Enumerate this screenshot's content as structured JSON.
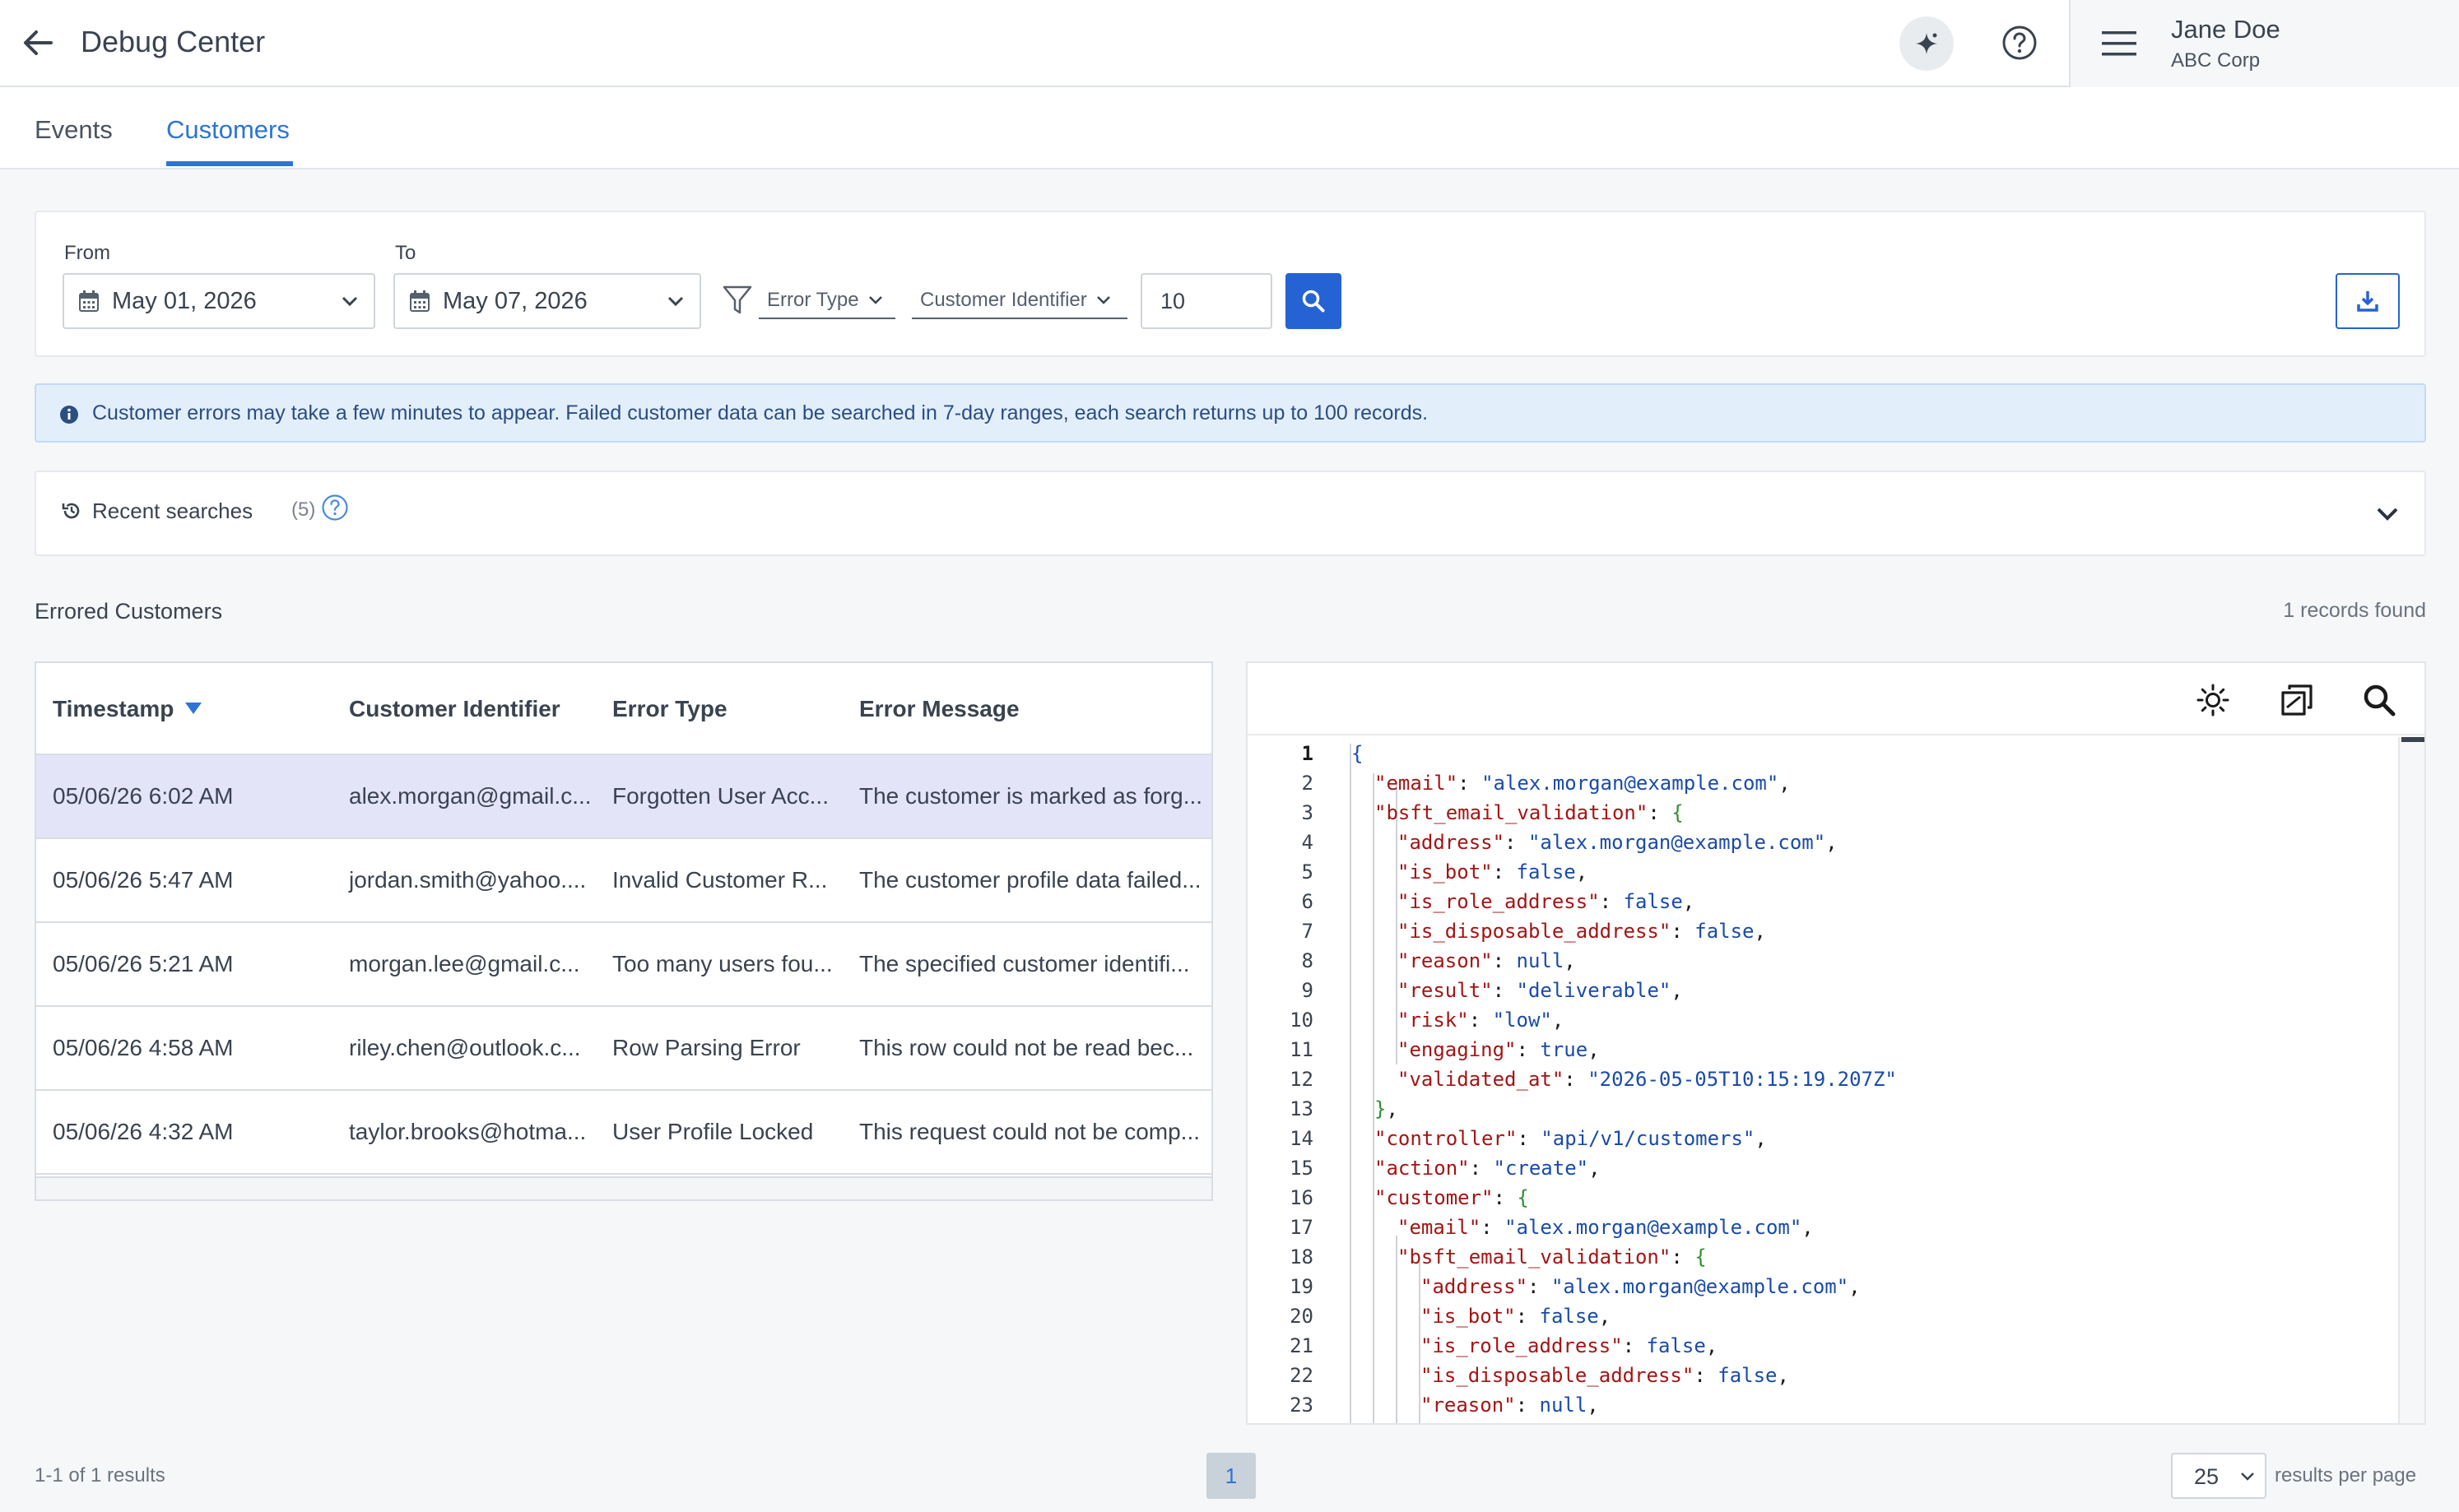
{
  "header": {
    "title": "Debug Center",
    "user_name": "Jane Doe",
    "user_org": "ABC Corp"
  },
  "tabs": [
    {
      "label": "Events",
      "active": false
    },
    {
      "label": "Customers",
      "active": true
    }
  ],
  "filters": {
    "from_label": "From",
    "from_value": "May 01, 2026",
    "to_label": "To",
    "to_value": "May 07, 2026",
    "error_type_label": "Error Type",
    "customer_identifier_label": "Customer Identifier",
    "limit_value": "10"
  },
  "info_banner": "Customer errors may take a few minutes to appear. Failed customer data can be searched in 7-day ranges, each search returns up to 100 records.",
  "recent_searches": {
    "label": "Recent searches",
    "count": "(5)"
  },
  "errored": {
    "title": "Errored Customers",
    "records_found": "1 records found"
  },
  "table": {
    "columns": [
      "Timestamp",
      "Customer Identifier",
      "Error Type",
      "Error Message"
    ],
    "rows": [
      {
        "timestamp": "05/06/26 6:02 AM",
        "identifier": "alex.morgan@gmail.c...",
        "error_type": "Forgotten User Acc...",
        "message": "The customer is marked as forg...",
        "selected": true
      },
      {
        "timestamp": "05/06/26 5:47 AM",
        "identifier": "jordan.smith@yahoo....",
        "error_type": "Invalid Customer R...",
        "message": "The customer profile data failed...",
        "selected": false
      },
      {
        "timestamp": "05/06/26 5:21 AM",
        "identifier": "morgan.lee@gmail.c...",
        "error_type": "Too many users fou...",
        "message": "The specified customer identifi...",
        "selected": false
      },
      {
        "timestamp": "05/06/26 4:58 AM",
        "identifier": "riley.chen@outlook.c...",
        "error_type": "Row Parsing Error",
        "message": "This row could not be read bec...",
        "selected": false
      },
      {
        "timestamp": "05/06/26 4:32 AM",
        "identifier": "taylor.brooks@hotma...",
        "error_type": "User Profile Locked",
        "message": "This request could not be comp...",
        "selected": false
      }
    ]
  },
  "json_viewer": {
    "icons": [
      "theme-icon",
      "copy-icon",
      "search-icon"
    ],
    "lines": [
      {
        "n": "1",
        "indent": 0,
        "parts": [
          [
            "br1",
            "{"
          ]
        ]
      },
      {
        "n": "2",
        "indent": 1,
        "parts": [
          [
            "k",
            "\"email\""
          ],
          [
            "p",
            ": "
          ],
          [
            "s",
            "\"alex.morgan@example.com\""
          ],
          [
            "p",
            ","
          ]
        ]
      },
      {
        "n": "3",
        "indent": 1,
        "parts": [
          [
            "k",
            "\"bsft_email_validation\""
          ],
          [
            "p",
            ": "
          ],
          [
            "br2",
            "{"
          ]
        ]
      },
      {
        "n": "4",
        "indent": 2,
        "parts": [
          [
            "k",
            "\"address\""
          ],
          [
            "p",
            ": "
          ],
          [
            "s",
            "\"alex.morgan@example.com\""
          ],
          [
            "p",
            ","
          ]
        ]
      },
      {
        "n": "5",
        "indent": 2,
        "parts": [
          [
            "k",
            "\"is_bot\""
          ],
          [
            "p",
            ": "
          ],
          [
            "b",
            "false"
          ],
          [
            "p",
            ","
          ]
        ]
      },
      {
        "n": "6",
        "indent": 2,
        "parts": [
          [
            "k",
            "\"is_role_address\""
          ],
          [
            "p",
            ": "
          ],
          [
            "b",
            "false"
          ],
          [
            "p",
            ","
          ]
        ]
      },
      {
        "n": "7",
        "indent": 2,
        "parts": [
          [
            "k",
            "\"is_disposable_address\""
          ],
          [
            "p",
            ": "
          ],
          [
            "b",
            "false"
          ],
          [
            "p",
            ","
          ]
        ]
      },
      {
        "n": "8",
        "indent": 2,
        "parts": [
          [
            "k",
            "\"reason\""
          ],
          [
            "p",
            ": "
          ],
          [
            "b",
            "null"
          ],
          [
            "p",
            ","
          ]
        ]
      },
      {
        "n": "9",
        "indent": 2,
        "parts": [
          [
            "k",
            "\"result\""
          ],
          [
            "p",
            ": "
          ],
          [
            "s",
            "\"deliverable\""
          ],
          [
            "p",
            ","
          ]
        ]
      },
      {
        "n": "10",
        "indent": 2,
        "parts": [
          [
            "k",
            "\"risk\""
          ],
          [
            "p",
            ": "
          ],
          [
            "s",
            "\"low\""
          ],
          [
            "p",
            ","
          ]
        ]
      },
      {
        "n": "11",
        "indent": 2,
        "parts": [
          [
            "k",
            "\"engaging\""
          ],
          [
            "p",
            ": "
          ],
          [
            "b",
            "true"
          ],
          [
            "p",
            ","
          ]
        ]
      },
      {
        "n": "12",
        "indent": 2,
        "parts": [
          [
            "k",
            "\"validated_at\""
          ],
          [
            "p",
            ": "
          ],
          [
            "s",
            "\"2026-05-05T10:15:19.207Z\""
          ]
        ]
      },
      {
        "n": "13",
        "indent": 1,
        "parts": [
          [
            "br2",
            "}"
          ],
          [
            "p",
            ","
          ]
        ]
      },
      {
        "n": "14",
        "indent": 1,
        "parts": [
          [
            "k",
            "\"controller\""
          ],
          [
            "p",
            ": "
          ],
          [
            "s",
            "\"api/v1/customers\""
          ],
          [
            "p",
            ","
          ]
        ]
      },
      {
        "n": "15",
        "indent": 1,
        "parts": [
          [
            "k",
            "\"action\""
          ],
          [
            "p",
            ": "
          ],
          [
            "s",
            "\"create\""
          ],
          [
            "p",
            ","
          ]
        ]
      },
      {
        "n": "16",
        "indent": 1,
        "parts": [
          [
            "k",
            "\"customer\""
          ],
          [
            "p",
            ": "
          ],
          [
            "br2",
            "{"
          ]
        ]
      },
      {
        "n": "17",
        "indent": 2,
        "parts": [
          [
            "k",
            "\"email\""
          ],
          [
            "p",
            ": "
          ],
          [
            "s",
            "\"alex.morgan@example.com\""
          ],
          [
            "p",
            ","
          ]
        ]
      },
      {
        "n": "18",
        "indent": 2,
        "parts": [
          [
            "k",
            "\"bsft_email_validation\""
          ],
          [
            "p",
            ": "
          ],
          [
            "br2",
            "{"
          ]
        ]
      },
      {
        "n": "19",
        "indent": 3,
        "parts": [
          [
            "k",
            "\"address\""
          ],
          [
            "p",
            ": "
          ],
          [
            "s",
            "\"alex.morgan@example.com\""
          ],
          [
            "p",
            ","
          ]
        ]
      },
      {
        "n": "20",
        "indent": 3,
        "parts": [
          [
            "k",
            "\"is_bot\""
          ],
          [
            "p",
            ": "
          ],
          [
            "b",
            "false"
          ],
          [
            "p",
            ","
          ]
        ]
      },
      {
        "n": "21",
        "indent": 3,
        "parts": [
          [
            "k",
            "\"is_role_address\""
          ],
          [
            "p",
            ": "
          ],
          [
            "b",
            "false"
          ],
          [
            "p",
            ","
          ]
        ]
      },
      {
        "n": "22",
        "indent": 3,
        "parts": [
          [
            "k",
            "\"is_disposable_address\""
          ],
          [
            "p",
            ": "
          ],
          [
            "b",
            "false"
          ],
          [
            "p",
            ","
          ]
        ]
      },
      {
        "n": "23",
        "indent": 3,
        "parts": [
          [
            "k",
            "\"reason\""
          ],
          [
            "p",
            ": "
          ],
          [
            "b",
            "null"
          ],
          [
            "p",
            ","
          ]
        ]
      }
    ]
  },
  "footer": {
    "results_summary": "1-1 of 1 results",
    "current_page": "1",
    "per_page_value": "25",
    "per_page_label": "results per page"
  },
  "colors": {
    "accent": "#2d74d6",
    "primary_button": "#2563d4",
    "selected_row": "#e4e4f8",
    "info_bg": "#e3eefb"
  }
}
